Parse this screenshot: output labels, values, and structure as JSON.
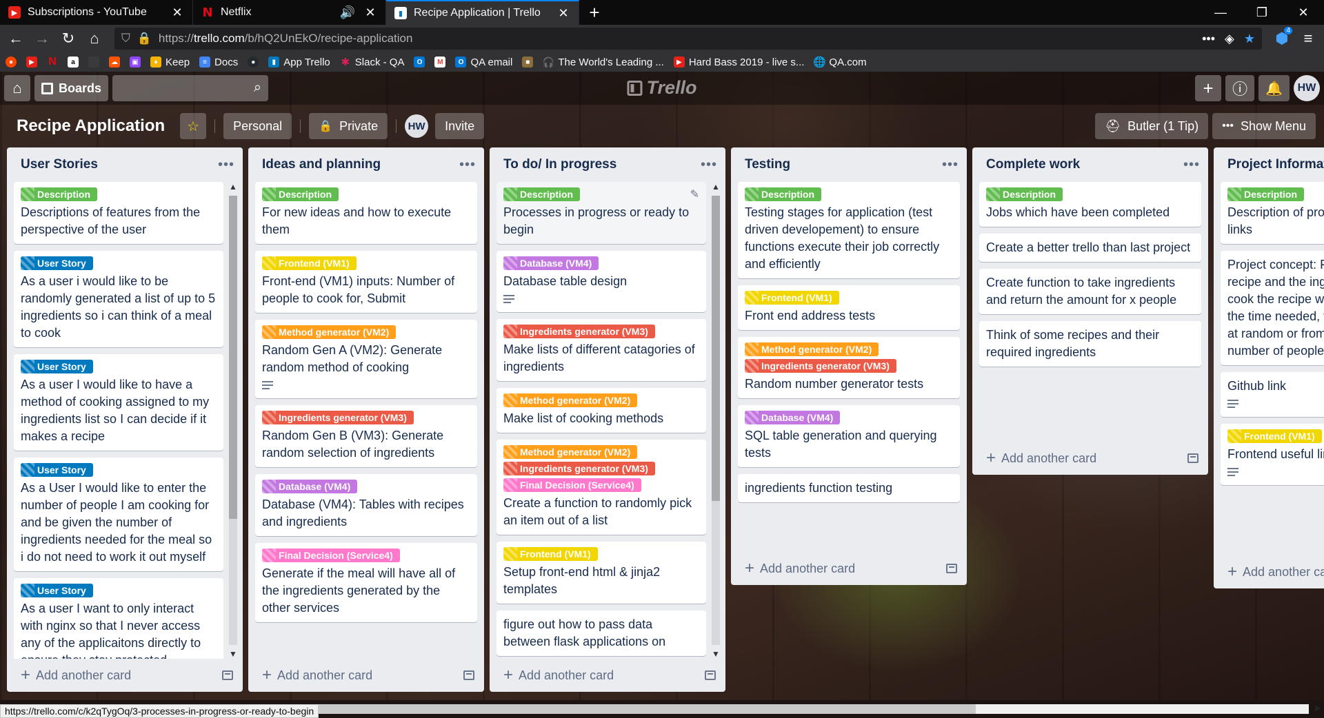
{
  "browser": {
    "tabs": [
      {
        "title": "Subscriptions - YouTube",
        "icon": "youtube-icon",
        "active": false
      },
      {
        "title": "Netflix",
        "icon": "netflix-icon",
        "active": false
      },
      {
        "title": "Recipe Application | Trello",
        "icon": "trello-icon",
        "active": true
      }
    ],
    "url": {
      "protocol": "https://",
      "host": "trello.com",
      "path": "/b/hQ2UnEkO/recipe-application"
    },
    "bookmarks": [
      "Keep",
      "Docs",
      "App Trello",
      "Slack - QA",
      "QA email",
      "The World's Leading ...",
      "Hard Bass 2019 - live s...",
      "QA.com"
    ],
    "notification_count": "4",
    "status_url": "https://trello.com/c/k2qTygOq/3-processes-in-progress-or-ready-to-begin"
  },
  "topbar": {
    "boards_label": "Boards",
    "search_placeholder": "",
    "logo_text": "Trello",
    "avatar": "HW"
  },
  "board": {
    "title": "Recipe Application",
    "visibility_team": "Personal",
    "visibility": "Private",
    "member_avatar": "HW",
    "invite_label": "Invite",
    "butler_label": "Butler (1 Tip)",
    "menu_label": "Show Menu"
  },
  "colors": {
    "green": "#61bd4f",
    "blue": "#0079bf",
    "yellow": "#f2d600",
    "orange": "#ff9f1a",
    "red": "#eb5a46",
    "purple": "#c377e0",
    "pink": "#ff78cb"
  },
  "add_card_label": "Add another card",
  "lists": [
    {
      "title": "User Stories",
      "cards": [
        {
          "labels": [
            {
              "text": "Description",
              "color": "green"
            }
          ],
          "title": "Descriptions of features from the perspective of the user",
          "desc": false
        },
        {
          "labels": [
            {
              "text": "User Story",
              "color": "blue"
            }
          ],
          "title": "As a user i would like to be randomly generated a list of up to 5 ingredients so i can think of a meal to cook",
          "desc": false
        },
        {
          "labels": [
            {
              "text": "User Story",
              "color": "blue"
            }
          ],
          "title": "As a user I would like to have a method of cooking assigned to my ingredients list so I can decide if it makes a recipe",
          "desc": false
        },
        {
          "labels": [
            {
              "text": "User Story",
              "color": "blue"
            }
          ],
          "title": "As a User I would like to enter the number of people I am cooking for and be given the number of ingredients needed for the meal so i do not need to work it out myself",
          "desc": false
        },
        {
          "labels": [
            {
              "text": "User Story",
              "color": "blue"
            }
          ],
          "title": "As a user I want to only interact with nginx so that I never access any of the applicaitons directly to ensure they stay protected",
          "desc": false
        }
      ]
    },
    {
      "title": "Ideas and planning",
      "cards": [
        {
          "labels": [
            {
              "text": "Description",
              "color": "green"
            }
          ],
          "title": "For new ideas and how to execute them",
          "desc": false
        },
        {
          "labels": [
            {
              "text": "Frontend (VM1)",
              "color": "yellow"
            }
          ],
          "title": "Front-end (VM1) inputs: Number of people to cook for, Submit",
          "desc": false
        },
        {
          "labels": [
            {
              "text": "Method generator (VM2)",
              "color": "orange"
            }
          ],
          "title": "Random Gen A (VM2): Generate random method of cooking",
          "desc": true
        },
        {
          "labels": [
            {
              "text": "Ingredients generator (VM3)",
              "color": "red"
            }
          ],
          "title": "Random Gen B (VM3): Generate random selection of ingredients",
          "desc": false
        },
        {
          "labels": [
            {
              "text": "Database (VM4)",
              "color": "purple"
            }
          ],
          "title": "Database (VM4): Tables with recipes and ingredients",
          "desc": false
        },
        {
          "labels": [
            {
              "text": "Final Decision (Service4)",
              "color": "pink"
            }
          ],
          "title": "Generate if the meal will have all of the ingredients generated by the other services",
          "desc": false
        }
      ]
    },
    {
      "title": "To do/ In progress",
      "cards": [
        {
          "labels": [
            {
              "text": "Description",
              "color": "green"
            }
          ],
          "title": "Processes in progress or ready to begin",
          "desc": false,
          "hover": true
        },
        {
          "labels": [
            {
              "text": "Database (VM4)",
              "color": "purple"
            }
          ],
          "title": "Database table design",
          "desc": true
        },
        {
          "labels": [
            {
              "text": "Ingredients generator (VM3)",
              "color": "red"
            }
          ],
          "title": "Make lists of different catagories of ingredients",
          "desc": false
        },
        {
          "labels": [
            {
              "text": "Method generator (VM2)",
              "color": "orange"
            }
          ],
          "title": "Make list of cooking methods",
          "desc": false
        },
        {
          "labels": [
            {
              "text": "Method generator (VM2)",
              "color": "orange"
            },
            {
              "text": "Ingredients generator (VM3)",
              "color": "red"
            },
            {
              "text": "Final Decision (Service4)",
              "color": "pink"
            }
          ],
          "title": "Create a function to randomly pick an item out of a list",
          "desc": false
        },
        {
          "labels": [
            {
              "text": "Frontend (VM1)",
              "color": "yellow"
            }
          ],
          "title": "Setup front-end html & jinja2 templates",
          "desc": false
        },
        {
          "labels": [],
          "title": "figure out how to pass data between flask applications on",
          "desc": false
        }
      ]
    },
    {
      "title": "Testing",
      "cards": [
        {
          "labels": [
            {
              "text": "Description",
              "color": "green"
            }
          ],
          "title": "Testing stages for application (test driven developement) to ensure functions execute their job correctly and efficiently",
          "desc": false
        },
        {
          "labels": [
            {
              "text": "Frontend (VM1)",
              "color": "yellow"
            }
          ],
          "title": "Front end address tests",
          "desc": false
        },
        {
          "labels": [
            {
              "text": "Method generator (VM2)",
              "color": "orange"
            },
            {
              "text": "Ingredients generator (VM3)",
              "color": "red"
            }
          ],
          "title": "Random number generator tests",
          "desc": false
        },
        {
          "labels": [
            {
              "text": "Database (VM4)",
              "color": "purple"
            }
          ],
          "title": "SQL table generation and querying tests",
          "desc": false
        },
        {
          "labels": [],
          "title": "ingredients function testing",
          "desc": false
        }
      ]
    },
    {
      "title": "Complete work",
      "cards": [
        {
          "labels": [
            {
              "text": "Description",
              "color": "green"
            }
          ],
          "title": "Jobs which have been completed",
          "desc": false
        },
        {
          "labels": [],
          "title": "Create a better trello than last project",
          "desc": false
        },
        {
          "labels": [],
          "title": "Create function to take ingredients and return the amount for x people",
          "desc": false
        },
        {
          "labels": [],
          "title": "Think of some recipes and their required ingredients",
          "desc": false
        }
      ]
    },
    {
      "title": "Project Information",
      "cards": [
        {
          "labels": [
            {
              "text": "Description",
              "color": "green"
            }
          ],
          "title": "Description of project and important links",
          "desc": false
        },
        {
          "labels": [],
          "title": "Project concept: Find a random recipe and the ingredients needed to cook the recipe with the number of the time needed, the number is found at random or from the random number of people",
          "desc": false
        },
        {
          "labels": [],
          "title": "Github link",
          "desc": true
        },
        {
          "labels": [
            {
              "text": "Frontend (VM1)",
              "color": "yellow"
            }
          ],
          "title": "Frontend useful links",
          "desc": true
        }
      ]
    }
  ]
}
